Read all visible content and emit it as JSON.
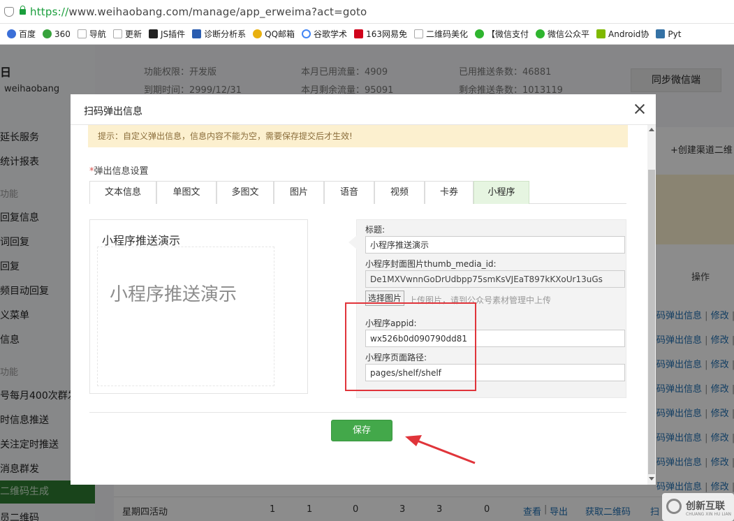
{
  "browser": {
    "url_scheme": "https://",
    "url_rest": "www.weihaobang.com/manage/app_erweima?act=goto",
    "bookmarks": [
      {
        "label": "百度",
        "icon": "baidu-icon",
        "color": "#3b6fd8"
      },
      {
        "label": "360",
        "icon": "360-icon",
        "color": "#37a33c"
      },
      {
        "label": "导航",
        "icon": "page-icon",
        "color": "#bbbbbb"
      },
      {
        "label": "更新",
        "icon": "page-icon",
        "color": "#bbbbbb"
      },
      {
        "label": "JS插件",
        "icon": "js-icon",
        "color": "#222222"
      },
      {
        "label": "诊断分析系",
        "icon": "diagnose-icon",
        "color": "#2a5db0"
      },
      {
        "label": "QQ邮箱",
        "icon": "chrome-icon",
        "color": "#e9b10f"
      },
      {
        "label": "谷歌学术",
        "icon": "google-icon",
        "color": "#4285f4"
      },
      {
        "label": "163网易免",
        "icon": "163-icon",
        "color": "#d0021b"
      },
      {
        "label": "二维码美化",
        "icon": "page-icon",
        "color": "#bbbbbb"
      },
      {
        "label": "【微信支付",
        "icon": "wechat-icon",
        "color": "#2fb52f"
      },
      {
        "label": "微信公众平",
        "icon": "wechat-icon",
        "color": "#2fb52f"
      },
      {
        "label": "Android协",
        "icon": "android-icon",
        "color": "#7fb900"
      },
      {
        "label": "Pyt",
        "icon": "python-icon",
        "color": "#3572a5"
      }
    ]
  },
  "background": {
    "logo_fragment": "日",
    "account": "weihaobang",
    "top_info": {
      "permission": "功能权限：开发版",
      "expire": "到期时间：2999/12/31",
      "used_flow": "本月已用流量：4909",
      "remain_flow": "本月剩余流量：95091",
      "used_push": "已用推送条数：46881",
      "remain_push": "剩余推送条数：1013119"
    },
    "sync_button": "同步微信端",
    "sidebar": [
      {
        "label": "延长服务",
        "type": "item"
      },
      {
        "label": "统计报表",
        "type": "item"
      },
      {
        "label": "功能",
        "type": "category"
      },
      {
        "label": "回复信息",
        "type": "item"
      },
      {
        "label": "词回复",
        "type": "item"
      },
      {
        "label": "回复",
        "type": "item"
      },
      {
        "label": "频目动回复",
        "type": "item"
      },
      {
        "label": "义菜单",
        "type": "item"
      },
      {
        "label": "信息",
        "type": "item"
      },
      {
        "label": "功能",
        "type": "category"
      },
      {
        "label": "号每月400次群发",
        "type": "item"
      },
      {
        "label": "时信息推送",
        "type": "item"
      },
      {
        "label": "关注定时推送",
        "type": "item"
      },
      {
        "label": "消息群发",
        "type": "item"
      }
    ],
    "sidebar_active": "二维码生成",
    "sidebar_last": "员二维码",
    "create_channel": "+创建渠道二维",
    "ops_header": "操作",
    "row_link_main": "码弹出信息",
    "row_link_edit": "修改",
    "row_link_more": "修",
    "bottom_row": {
      "name": "星期四活动",
      "values": [
        "1",
        "1",
        "0",
        "3",
        "3",
        "0"
      ],
      "view": "查看",
      "export": "导出",
      "get_qr": "获取二维码",
      "tail": "扫"
    }
  },
  "modal": {
    "title": "扫码弹出信息",
    "notice": "提示：自定义弹出信息，信息内容不能为空，需要保存提交后才生效!",
    "section_required_mark": "*",
    "section_label": "弹出信息设置",
    "tabs": [
      {
        "label": "文本信息",
        "active": false
      },
      {
        "label": "单图文",
        "active": false
      },
      {
        "label": "多图文",
        "active": false
      },
      {
        "label": "图片",
        "active": false
      },
      {
        "label": "语音",
        "active": false
      },
      {
        "label": "视频",
        "active": false
      },
      {
        "label": "卡券",
        "active": false
      },
      {
        "label": "小程序",
        "active": true
      }
    ],
    "preview": {
      "title": "小程序推送演示",
      "big_text": "小程序推送演示"
    },
    "form": {
      "title_label": "标题:",
      "title_value": "小程序推送演示",
      "cover_label": "小程序封面图片thumb_media_id:",
      "cover_value": "De1MXVwnnGoDrUdbpp75smKsVJEaT897kKXoUr13uGs",
      "pick_button": "选择图片",
      "upload_hint": "上传图片，请到公众号素材管理中上传",
      "appid_label": "小程序appid:",
      "appid_value": "wx526b0d090790dd81",
      "path_label": "小程序页面路径:",
      "path_value": "pages/shelf/shelf"
    },
    "save_button": "保存"
  },
  "watermark": {
    "text": "创新互联",
    "sub": "CHUANG XIN HU LIAN"
  },
  "colors": {
    "accent_green": "#43a84a",
    "notice_bg": "#fcf0cf",
    "annotation_red": "#e0343a",
    "active_tab_bg": "#e6f5e1"
  }
}
